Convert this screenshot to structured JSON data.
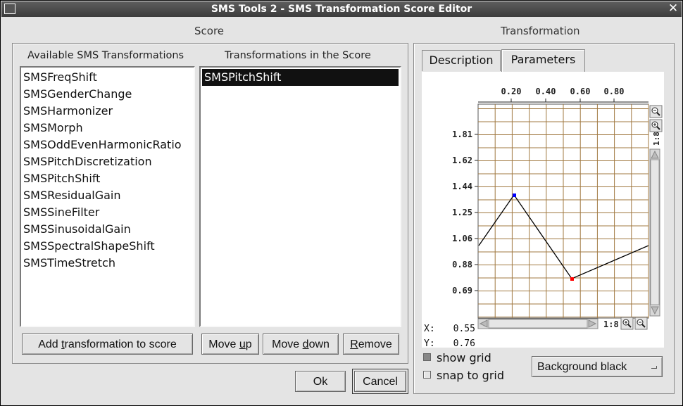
{
  "window": {
    "title": "SMS Tools 2 - SMS Transformation Score Editor",
    "close_glyph": "✕"
  },
  "score": {
    "title": "Score",
    "available": {
      "header": "Available SMS Transformations",
      "items": [
        "SMSFreqShift",
        "SMSGenderChange",
        "SMSHarmonizer",
        "SMSMorph",
        "SMSOddEvenHarmonicRatio",
        "SMSPitchDiscretization",
        "SMSPitchShift",
        "SMSResidualGain",
        "SMSSineFilter",
        "SMSSinusoidalGain",
        "SMSSpectralShapeShift",
        "SMSTimeStretch"
      ]
    },
    "in_score": {
      "header": "Transformations in the Score",
      "items": [
        "SMSPitchShift"
      ],
      "selected_index": 0
    },
    "buttons": {
      "add": {
        "pre": "Add ",
        "mnemonic": "t",
        "post": "ransformation to score"
      },
      "move_up": {
        "pre": "Move ",
        "mnemonic": "u",
        "post": "p"
      },
      "move_down": {
        "pre": "Move ",
        "mnemonic": "d",
        "post": "own"
      },
      "remove": {
        "pre": "",
        "mnemonic": "R",
        "post": "emove"
      }
    }
  },
  "transformation": {
    "title": "Transformation",
    "tabs": [
      "Description",
      "Parameters"
    ],
    "active_tab": "Parameters",
    "graph": {
      "x_ticks": [
        "0.20",
        "0.40",
        "0.60",
        "0.80"
      ],
      "y_ticks": [
        "1.81",
        "1.62",
        "1.44",
        "1.25",
        "1.06",
        "0.88",
        "0.69"
      ],
      "zoom_label": "1:8",
      "h_zoom_label": "1:8",
      "readout": {
        "x_label": "X:",
        "x_value": "0.55",
        "y_label": "Y:",
        "y_value": "0.76"
      }
    },
    "show_grid": {
      "label": "show grid",
      "checked": true
    },
    "snap_to_grid": {
      "label": "snap to grid",
      "checked": false
    },
    "background_button": "Background black"
  },
  "dialog": {
    "ok": "Ok",
    "cancel": "Cancel"
  },
  "colors": {
    "grid": "#a07840",
    "curve": "#000000",
    "point_selected": "#0000ff",
    "point_active": "#ff0000"
  }
}
